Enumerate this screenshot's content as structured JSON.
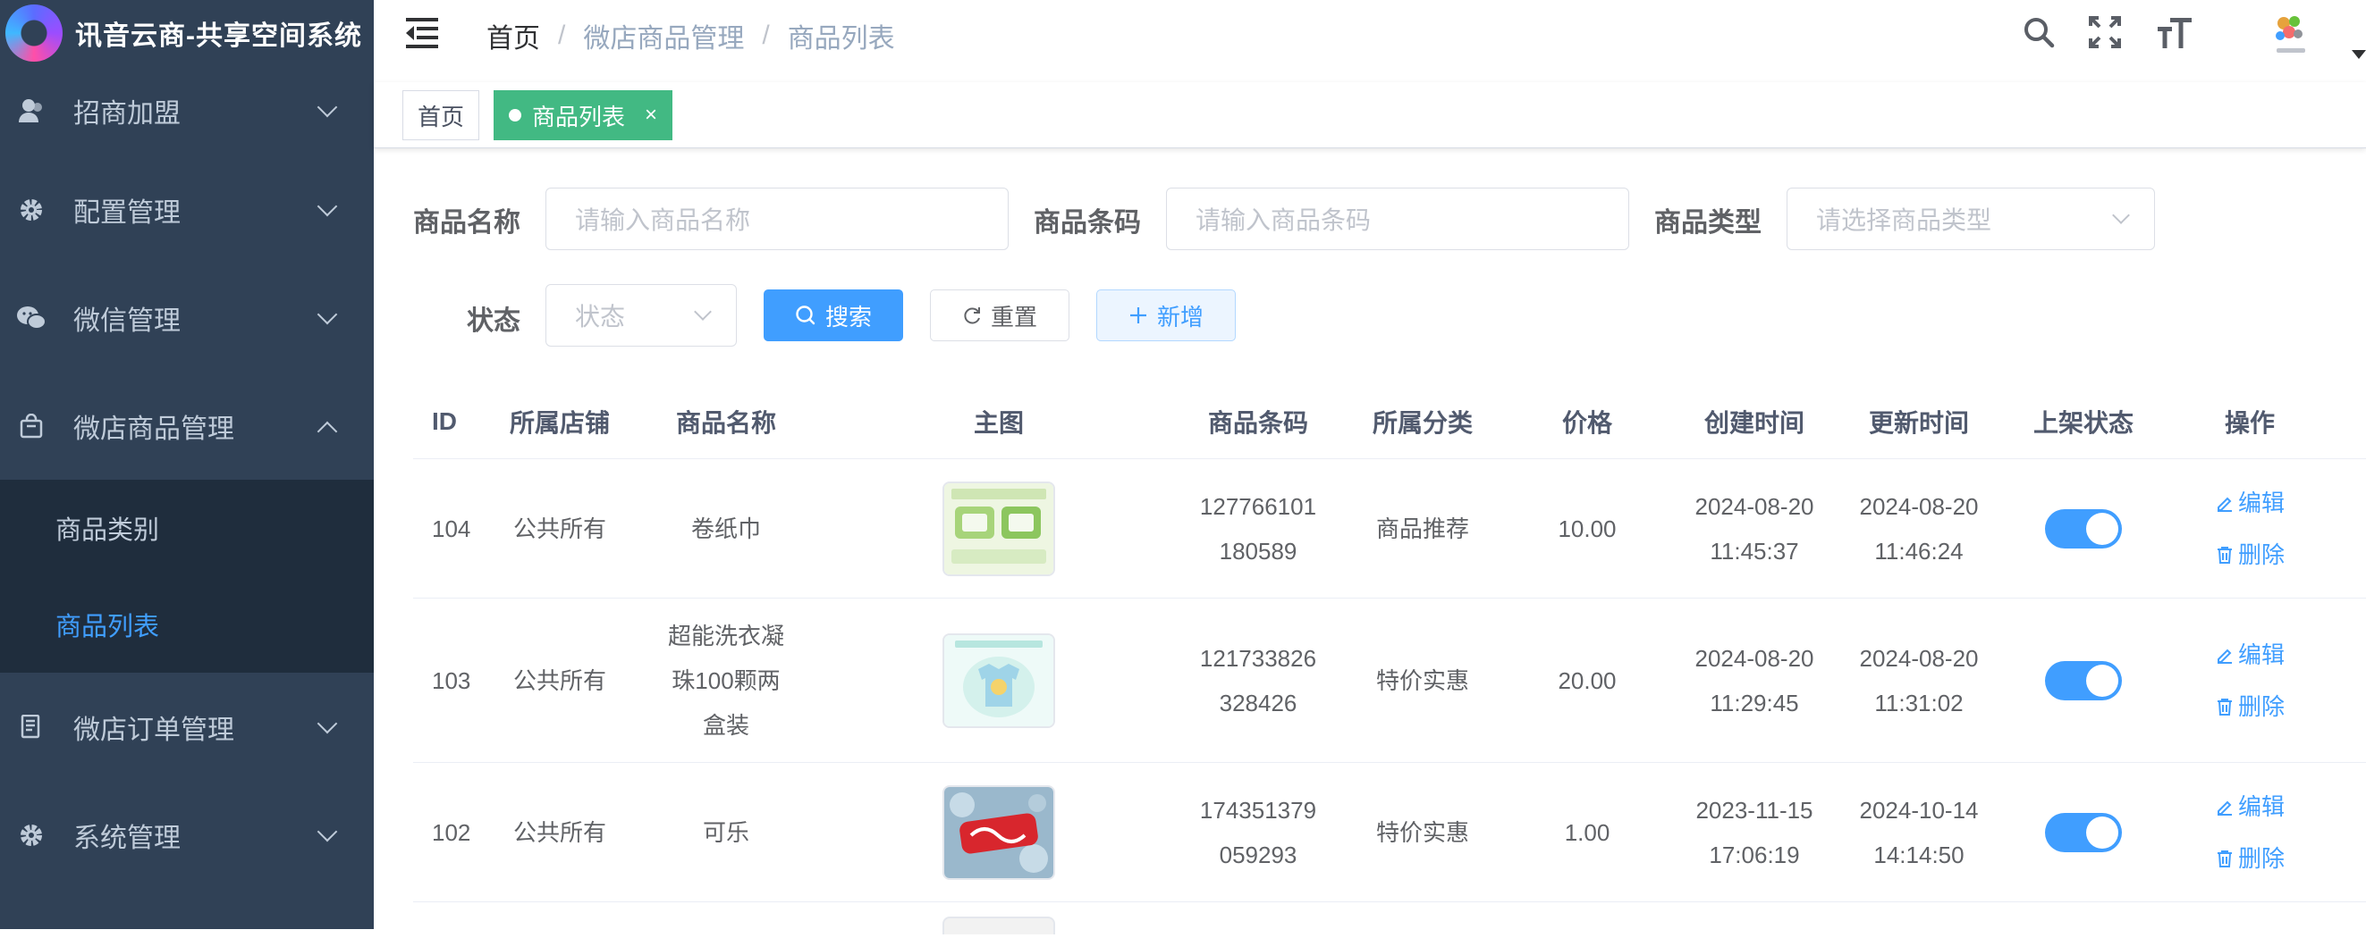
{
  "app": {
    "title": "讯音云商-共享空间系统"
  },
  "sidebar": {
    "items": [
      {
        "label": "招商加盟",
        "icon": "user-icon"
      },
      {
        "label": "配置管理",
        "icon": "gear-icon"
      },
      {
        "label": "微信管理",
        "icon": "wechat-icon"
      },
      {
        "label": "微店商品管理",
        "icon": "shopping-bag-icon",
        "expanded": true,
        "children": [
          {
            "label": "商品类别"
          },
          {
            "label": "商品列表",
            "active": true
          }
        ]
      },
      {
        "label": "微店订单管理",
        "icon": "document-icon"
      },
      {
        "label": "系统管理",
        "icon": "gear-icon"
      }
    ]
  },
  "header": {
    "breadcrumb": [
      "首页",
      "微店商品管理",
      "商品列表"
    ],
    "separator": "/"
  },
  "tags": {
    "items": [
      {
        "label": "首页"
      },
      {
        "label": "商品列表",
        "active": true,
        "close": "×"
      }
    ]
  },
  "search": {
    "name_label": "商品名称",
    "name_placeholder": "请输入商品名称",
    "code_label": "商品条码",
    "code_placeholder": "请输入商品条码",
    "type_label": "商品类型",
    "type_placeholder": "请选择商品类型",
    "status_label": "状态",
    "status_placeholder": "状态",
    "search_button": "搜索",
    "reset_button": "重置",
    "add_button": "新增"
  },
  "table": {
    "columns": [
      "ID",
      "所属店铺",
      "商品名称",
      "主图",
      "商品条码",
      "所属分类",
      "价格",
      "创建时间",
      "更新时间",
      "上架状态",
      "操作"
    ],
    "rows": [
      {
        "id": "104",
        "shop": "公共所有",
        "name": [
          "卷纸巾"
        ],
        "code": [
          "127766101",
          "180589"
        ],
        "category": "商品推荐",
        "price": "10.00",
        "created": [
          "2024-08-20",
          "11:45:37"
        ],
        "updated": [
          "2024-08-20",
          "11:46:24"
        ],
        "on_shelf": true
      },
      {
        "id": "103",
        "shop": "公共所有",
        "name": [
          "超能洗衣凝",
          "珠100颗两",
          "盒装"
        ],
        "code": [
          "121733826",
          "328426"
        ],
        "category": "特价实惠",
        "price": "20.00",
        "created": [
          "2024-08-20",
          "11:29:45"
        ],
        "updated": [
          "2024-08-20",
          "11:31:02"
        ],
        "on_shelf": true
      },
      {
        "id": "102",
        "shop": "公共所有",
        "name": [
          "可乐"
        ],
        "code": [
          "174351379",
          "059293"
        ],
        "category": "特价实惠",
        "price": "1.00",
        "created": [
          "2023-11-15",
          "17:06:19"
        ],
        "updated": [
          "2024-10-14",
          "14:14:50"
        ],
        "on_shelf": true
      }
    ],
    "edit_label": "编辑",
    "delete_label": "删除"
  },
  "colors": {
    "sidebar_bg": "#304156",
    "submenu_bg": "#1f2d3d",
    "accent": "#409eff",
    "tag_active": "#42b983"
  }
}
